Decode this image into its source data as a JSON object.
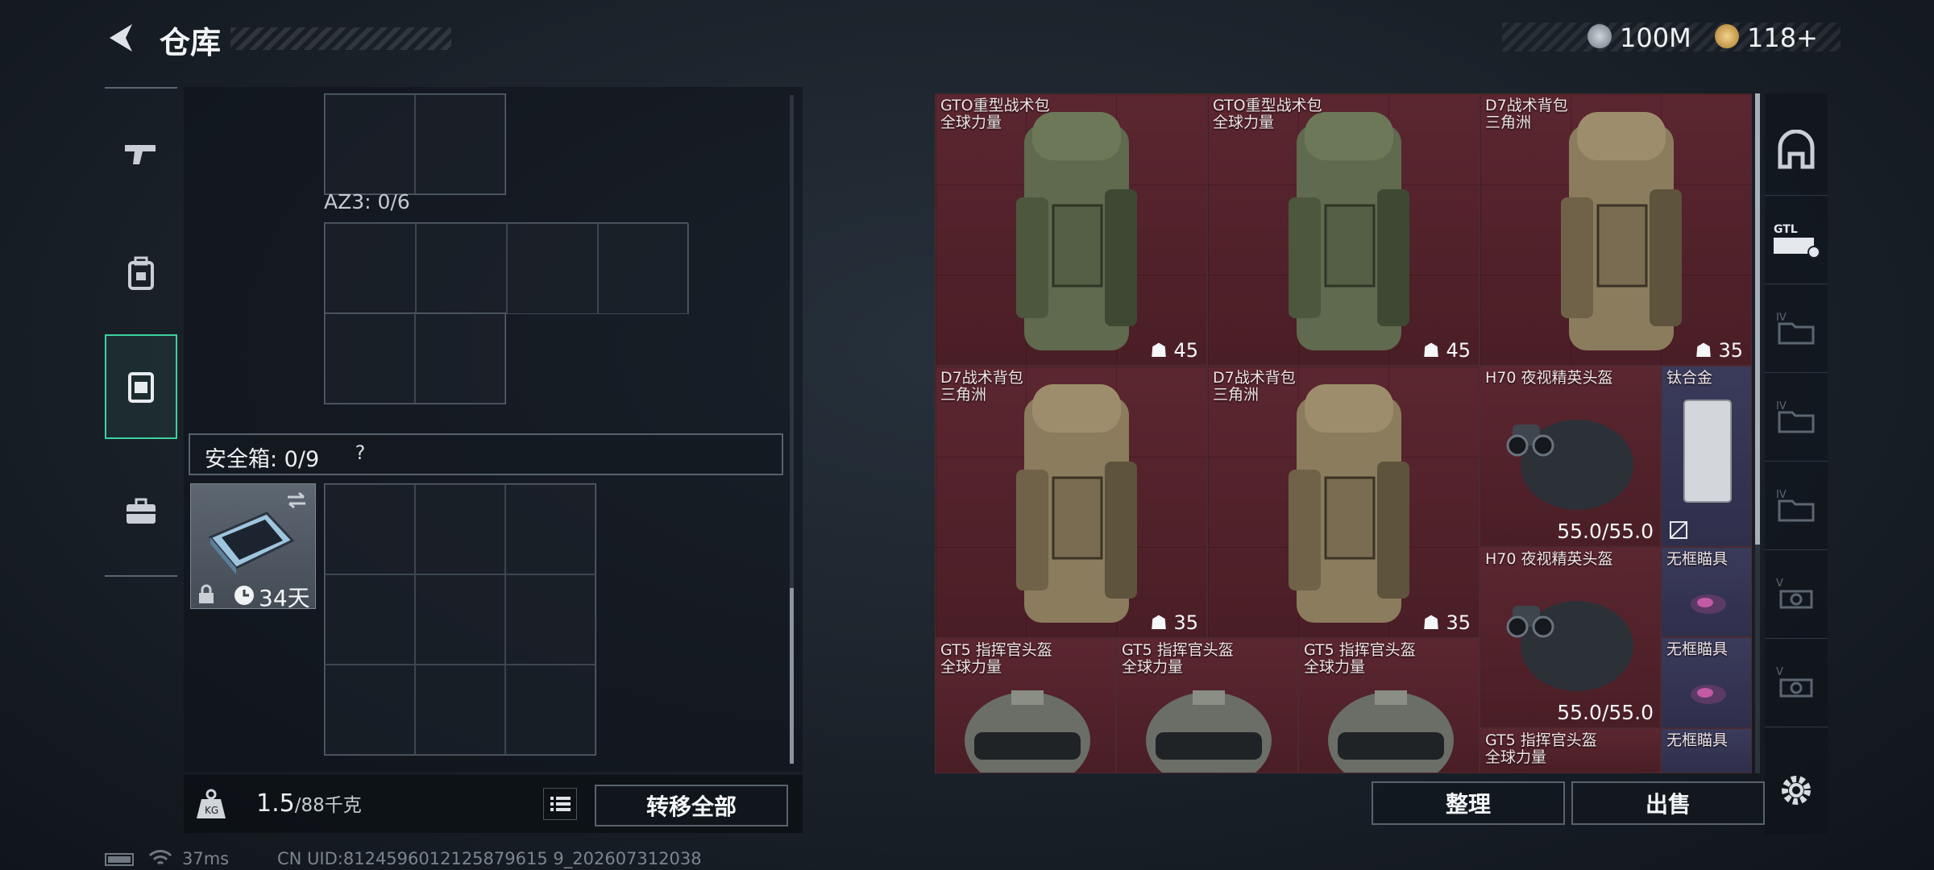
{
  "header": {
    "title": "仓库",
    "currency_1": "100M",
    "currency_2": "118+"
  },
  "side_tabs": [
    "pistol-icon",
    "backpack-icon",
    "vest-icon",
    "briefcase-icon"
  ],
  "container": {
    "az3_label": "AZ3: 0/6",
    "safe_box_label": "安全箱: 0/9",
    "help": "?",
    "safe_item_timer": "34天"
  },
  "footer": {
    "weight_current": "1.5",
    "weight_max": "/88千克",
    "transfer_all": "转移全部",
    "organize": "整理",
    "sell": "出售"
  },
  "status": {
    "ping": "37ms",
    "uid": "CN UID:8124596012125879615 9_202607312038"
  },
  "stash_items": [
    {
      "name": "GTO重型战术包",
      "origin": "全球力量",
      "capacity": "45"
    },
    {
      "name": "GTO重型战术包",
      "origin": "全球力量",
      "capacity": "45"
    },
    {
      "name": "D7战术背包",
      "origin": "三角洲",
      "capacity": "35"
    },
    {
      "name": "D7战术背包",
      "origin": "三角洲",
      "capacity": "35"
    },
    {
      "name": "D7战术背包",
      "origin": "三角洲",
      "capacity": "35"
    },
    {
      "name": "H70 夜视精英头盔",
      "durability": "55.0/55.0"
    },
    {
      "name": "钛合金"
    },
    {
      "name": "H70 夜视精英头盔",
      "durability": "55.0/55.0"
    },
    {
      "name": "无框瞄具"
    },
    {
      "name": "无框瞄具"
    },
    {
      "name": "GT5 指挥官头盔",
      "origin": "全球力量"
    },
    {
      "name": "GT5 指挥官头盔",
      "origin": "全球力量"
    },
    {
      "name": "GT5 指挥官头盔",
      "origin": "全球力量"
    },
    {
      "name": "GT5 指挥官头盔",
      "origin": "全球力量"
    },
    {
      "name": "无框瞄具"
    }
  ],
  "rail": [
    "armor-icon",
    "gtl-icon",
    "iv-folder-icon",
    "iv-folder-icon",
    "iv-folder-icon",
    "v-scope-icon",
    "v-scope-icon",
    "settings-icon"
  ]
}
